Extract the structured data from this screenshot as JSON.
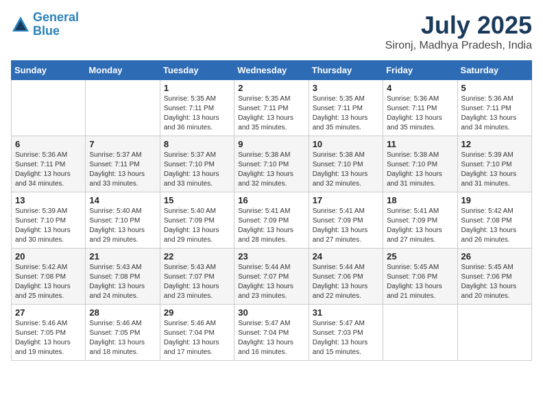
{
  "header": {
    "logo_line1": "General",
    "logo_line2": "Blue",
    "main_title": "July 2025",
    "subtitle": "Sironj, Madhya Pradesh, India"
  },
  "weekdays": [
    "Sunday",
    "Monday",
    "Tuesday",
    "Wednesday",
    "Thursday",
    "Friday",
    "Saturday"
  ],
  "weeks": [
    [
      {
        "day": "",
        "sunrise": "",
        "sunset": "",
        "daylight": ""
      },
      {
        "day": "",
        "sunrise": "",
        "sunset": "",
        "daylight": ""
      },
      {
        "day": "1",
        "sunrise": "Sunrise: 5:35 AM",
        "sunset": "Sunset: 7:11 PM",
        "daylight": "Daylight: 13 hours and 36 minutes."
      },
      {
        "day": "2",
        "sunrise": "Sunrise: 5:35 AM",
        "sunset": "Sunset: 7:11 PM",
        "daylight": "Daylight: 13 hours and 35 minutes."
      },
      {
        "day": "3",
        "sunrise": "Sunrise: 5:35 AM",
        "sunset": "Sunset: 7:11 PM",
        "daylight": "Daylight: 13 hours and 35 minutes."
      },
      {
        "day": "4",
        "sunrise": "Sunrise: 5:36 AM",
        "sunset": "Sunset: 7:11 PM",
        "daylight": "Daylight: 13 hours and 35 minutes."
      },
      {
        "day": "5",
        "sunrise": "Sunrise: 5:36 AM",
        "sunset": "Sunset: 7:11 PM",
        "daylight": "Daylight: 13 hours and 34 minutes."
      }
    ],
    [
      {
        "day": "6",
        "sunrise": "Sunrise: 5:36 AM",
        "sunset": "Sunset: 7:11 PM",
        "daylight": "Daylight: 13 hours and 34 minutes."
      },
      {
        "day": "7",
        "sunrise": "Sunrise: 5:37 AM",
        "sunset": "Sunset: 7:11 PM",
        "daylight": "Daylight: 13 hours and 33 minutes."
      },
      {
        "day": "8",
        "sunrise": "Sunrise: 5:37 AM",
        "sunset": "Sunset: 7:10 PM",
        "daylight": "Daylight: 13 hours and 33 minutes."
      },
      {
        "day": "9",
        "sunrise": "Sunrise: 5:38 AM",
        "sunset": "Sunset: 7:10 PM",
        "daylight": "Daylight: 13 hours and 32 minutes."
      },
      {
        "day": "10",
        "sunrise": "Sunrise: 5:38 AM",
        "sunset": "Sunset: 7:10 PM",
        "daylight": "Daylight: 13 hours and 32 minutes."
      },
      {
        "day": "11",
        "sunrise": "Sunrise: 5:38 AM",
        "sunset": "Sunset: 7:10 PM",
        "daylight": "Daylight: 13 hours and 31 minutes."
      },
      {
        "day": "12",
        "sunrise": "Sunrise: 5:39 AM",
        "sunset": "Sunset: 7:10 PM",
        "daylight": "Daylight: 13 hours and 31 minutes."
      }
    ],
    [
      {
        "day": "13",
        "sunrise": "Sunrise: 5:39 AM",
        "sunset": "Sunset: 7:10 PM",
        "daylight": "Daylight: 13 hours and 30 minutes."
      },
      {
        "day": "14",
        "sunrise": "Sunrise: 5:40 AM",
        "sunset": "Sunset: 7:10 PM",
        "daylight": "Daylight: 13 hours and 29 minutes."
      },
      {
        "day": "15",
        "sunrise": "Sunrise: 5:40 AM",
        "sunset": "Sunset: 7:09 PM",
        "daylight": "Daylight: 13 hours and 29 minutes."
      },
      {
        "day": "16",
        "sunrise": "Sunrise: 5:41 AM",
        "sunset": "Sunset: 7:09 PM",
        "daylight": "Daylight: 13 hours and 28 minutes."
      },
      {
        "day": "17",
        "sunrise": "Sunrise: 5:41 AM",
        "sunset": "Sunset: 7:09 PM",
        "daylight": "Daylight: 13 hours and 27 minutes."
      },
      {
        "day": "18",
        "sunrise": "Sunrise: 5:41 AM",
        "sunset": "Sunset: 7:09 PM",
        "daylight": "Daylight: 13 hours and 27 minutes."
      },
      {
        "day": "19",
        "sunrise": "Sunrise: 5:42 AM",
        "sunset": "Sunset: 7:08 PM",
        "daylight": "Daylight: 13 hours and 26 minutes."
      }
    ],
    [
      {
        "day": "20",
        "sunrise": "Sunrise: 5:42 AM",
        "sunset": "Sunset: 7:08 PM",
        "daylight": "Daylight: 13 hours and 25 minutes."
      },
      {
        "day": "21",
        "sunrise": "Sunrise: 5:43 AM",
        "sunset": "Sunset: 7:08 PM",
        "daylight": "Daylight: 13 hours and 24 minutes."
      },
      {
        "day": "22",
        "sunrise": "Sunrise: 5:43 AM",
        "sunset": "Sunset: 7:07 PM",
        "daylight": "Daylight: 13 hours and 23 minutes."
      },
      {
        "day": "23",
        "sunrise": "Sunrise: 5:44 AM",
        "sunset": "Sunset: 7:07 PM",
        "daylight": "Daylight: 13 hours and 23 minutes."
      },
      {
        "day": "24",
        "sunrise": "Sunrise: 5:44 AM",
        "sunset": "Sunset: 7:06 PM",
        "daylight": "Daylight: 13 hours and 22 minutes."
      },
      {
        "day": "25",
        "sunrise": "Sunrise: 5:45 AM",
        "sunset": "Sunset: 7:06 PM",
        "daylight": "Daylight: 13 hours and 21 minutes."
      },
      {
        "day": "26",
        "sunrise": "Sunrise: 5:45 AM",
        "sunset": "Sunset: 7:06 PM",
        "daylight": "Daylight: 13 hours and 20 minutes."
      }
    ],
    [
      {
        "day": "27",
        "sunrise": "Sunrise: 5:46 AM",
        "sunset": "Sunset: 7:05 PM",
        "daylight": "Daylight: 13 hours and 19 minutes."
      },
      {
        "day": "28",
        "sunrise": "Sunrise: 5:46 AM",
        "sunset": "Sunset: 7:05 PM",
        "daylight": "Daylight: 13 hours and 18 minutes."
      },
      {
        "day": "29",
        "sunrise": "Sunrise: 5:46 AM",
        "sunset": "Sunset: 7:04 PM",
        "daylight": "Daylight: 13 hours and 17 minutes."
      },
      {
        "day": "30",
        "sunrise": "Sunrise: 5:47 AM",
        "sunset": "Sunset: 7:04 PM",
        "daylight": "Daylight: 13 hours and 16 minutes."
      },
      {
        "day": "31",
        "sunrise": "Sunrise: 5:47 AM",
        "sunset": "Sunset: 7:03 PM",
        "daylight": "Daylight: 13 hours and 15 minutes."
      },
      {
        "day": "",
        "sunrise": "",
        "sunset": "",
        "daylight": ""
      },
      {
        "day": "",
        "sunrise": "",
        "sunset": "",
        "daylight": ""
      }
    ]
  ]
}
